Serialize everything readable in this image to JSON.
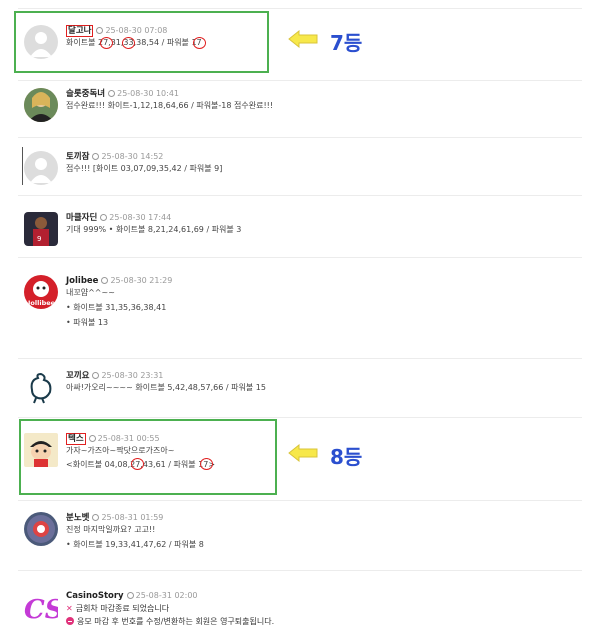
{
  "posts": [
    {
      "name": "달고나",
      "time": "25-08-30 07:08",
      "lines": [
        "화이트볼 27,31,33,38,54 / 파워볼 17"
      ]
    },
    {
      "name": "슬롯중독녀",
      "time": "25-08-30 10:41",
      "lines": [
        "접수완료!!! 화이트-1,12,18,64,66 / 파워볼-18 접수완료!!!"
      ]
    },
    {
      "name": "토끼잠",
      "time": "25-08-30 14:52",
      "lines": [
        "접수!!! [화이트 03,07,09,35,42 / 파워볼 9]"
      ]
    },
    {
      "name": "마클자딘",
      "time": "25-08-30 17:44",
      "lines": [
        "기대 999% • 화이트볼 8,21,24,61,69 / 파워볼 3"
      ]
    },
    {
      "name": "Jolibee",
      "time": "25-08-30 21:29",
      "lines": [
        "내꼬얌^^~~",
        "• 화이트볼 31,35,36,38,41",
        "• 파워볼 13"
      ]
    },
    {
      "name": "꼬끼요",
      "time": "25-08-30 23:31",
      "lines": [
        "아싸!가오리~~~~ 화이트볼 5,42,48,57,66 / 파워볼 15"
      ]
    },
    {
      "name": "텍스",
      "time": "25-08-31 00:55",
      "lines": [
        "가자~가즈아~짝닷으로가즈아~",
        "<화이트볼 04,08,27,43,61 / 파워볼 17>"
      ]
    },
    {
      "name": "분노벳",
      "time": "25-08-31 01:59",
      "lines": [
        "진정 마지막일까요? 고고!!",
        "• 화이트볼 19,33,41,47,62 / 파워볼 8"
      ]
    },
    {
      "name": "CasinoStory",
      "time": "25-08-31 02:00",
      "lines": [
        "금회차 마감종료 되었습니다",
        "응모 마감 후 번호를 수정/변환하는 회원은 영구퇴출됩니다."
      ]
    }
  ],
  "ranks": {
    "first": "7등",
    "second": "8등"
  },
  "colors": {
    "highlight": "#4cb050",
    "rank_text": "#2b4fcf",
    "circle": "#e02020",
    "arrow": "#f7e84a"
  }
}
